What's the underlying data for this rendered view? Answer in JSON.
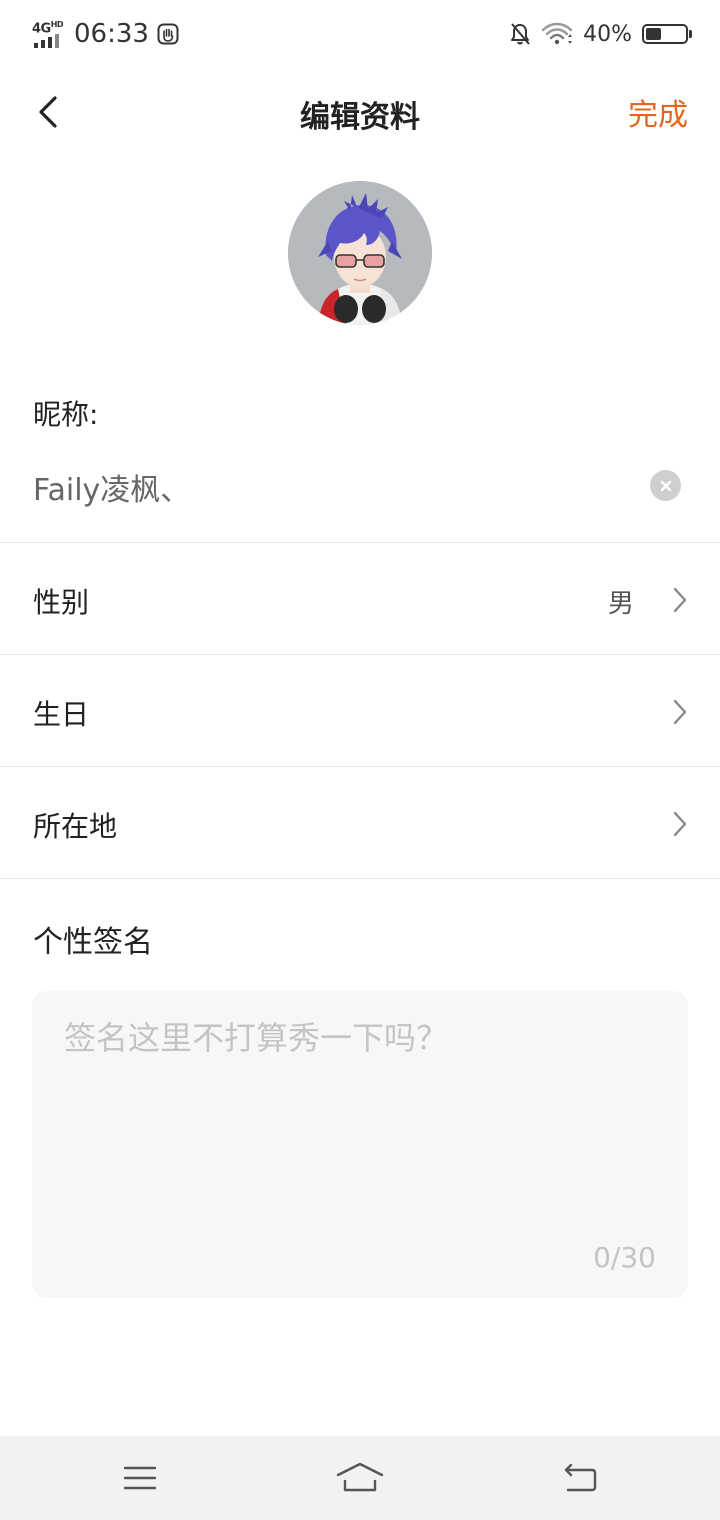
{
  "status_bar": {
    "network": "4G",
    "network_sup": "HD",
    "time": "06:33",
    "battery_percent": "40%",
    "battery_level": 0.4,
    "icons": [
      "signal-icon",
      "gesture-hand-icon",
      "bell-muted-icon",
      "wifi-icon",
      "battery-icon"
    ]
  },
  "nav": {
    "title": "编辑资料",
    "done_label": "完成",
    "back_icon": "chevron-left-icon"
  },
  "colors": {
    "accent": "#e8641e",
    "text_primary": "#222222",
    "placeholder": "#c4c4c4",
    "input_bg": "#f7f7f7",
    "sysnav_bg": "#f2f2f2"
  },
  "profile": {
    "avatar_alt": "avatar",
    "nickname_label": "昵称:",
    "nickname_value": "Faily凌枫、",
    "rows": [
      {
        "label": "性别",
        "value": "男"
      },
      {
        "label": "生日",
        "value": ""
      },
      {
        "label": "所在地",
        "value": ""
      }
    ],
    "signature_label": "个性签名",
    "signature_placeholder": "签名这里不打算秀一下吗？",
    "signature_value": "",
    "signature_count": "0/30"
  },
  "system_nav": {
    "icons": [
      "menu-icon",
      "home-icon",
      "back-arrow-icon"
    ]
  }
}
